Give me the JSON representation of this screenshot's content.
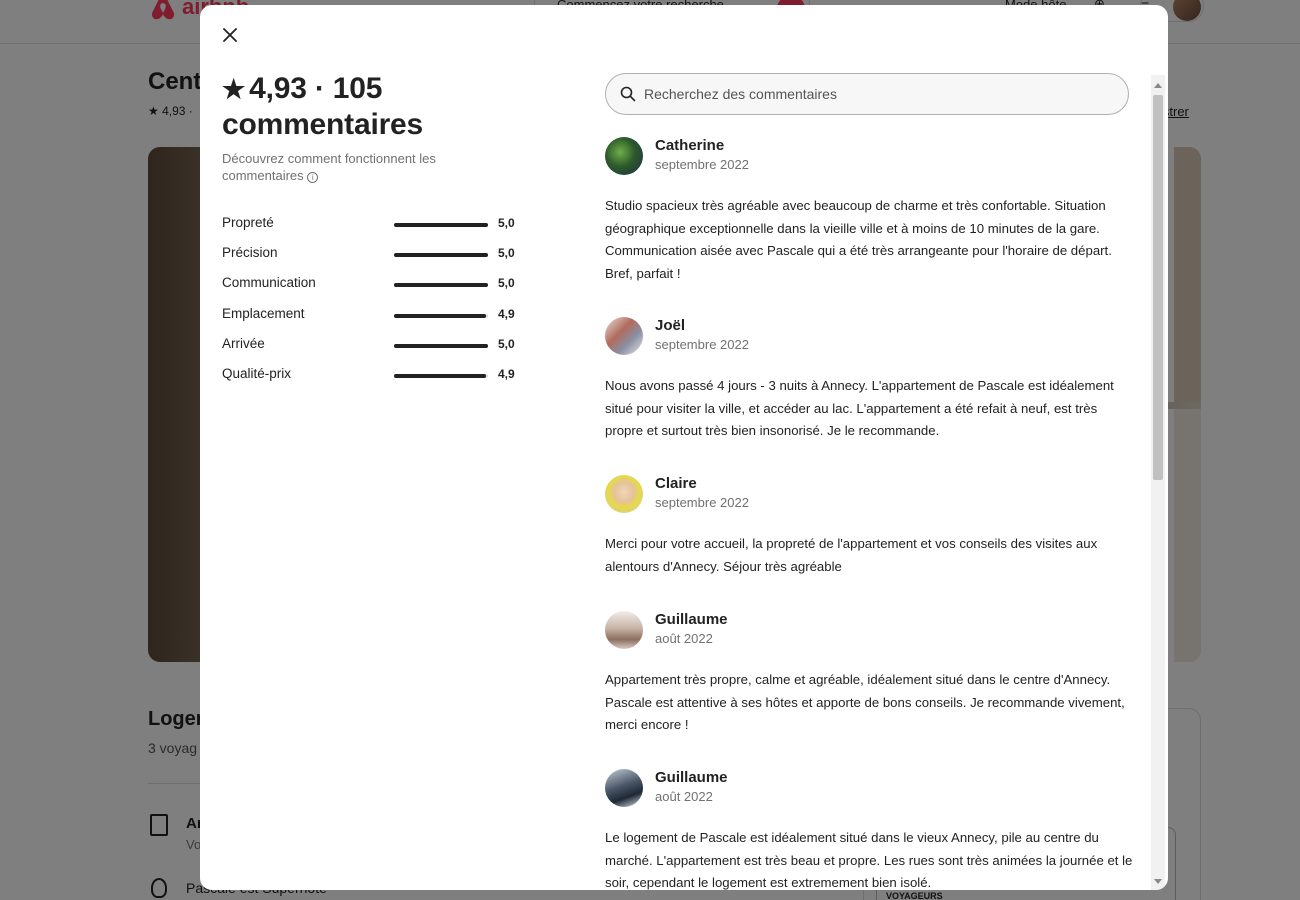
{
  "background": {
    "logo_text": "airbnb",
    "search_text": "Commencez votre recherche",
    "host_mode": "Mode hôte",
    "listing_title": "Cent",
    "listing_sub": "★ 4,93 ·",
    "save_link": "istrer",
    "lodging_heading": "Logem",
    "guests_text": "3 voyag",
    "amenity_1": "Ar",
    "amenity_1_sub": "Vo",
    "amenity_2": "Pascale est Superhôte",
    "card_label": "VOYAGEURS"
  },
  "modal": {
    "close_label": "×",
    "rating": "4,93",
    "review_count_label": "105 commentaires",
    "separator": "·",
    "how_reviews_work": "Découvrez comment fonctionnent les commentaires",
    "info_icon": "i",
    "categories": [
      {
        "name": "Propreté",
        "score": "5,0",
        "value": 5.0
      },
      {
        "name": "Précision",
        "score": "5,0",
        "value": 5.0
      },
      {
        "name": "Communication",
        "score": "5,0",
        "value": 5.0
      },
      {
        "name": "Emplacement",
        "score": "4,9",
        "value": 4.9
      },
      {
        "name": "Arrivée",
        "score": "5,0",
        "value": 5.0
      },
      {
        "name": "Qualité-prix",
        "score": "4,9",
        "value": 4.9
      }
    ],
    "search": {
      "placeholder": "Recherchez des commentaires",
      "value": ""
    },
    "reviews": [
      {
        "name": "Catherine",
        "date": "septembre 2022",
        "text": "Studio spacieux très agréable avec beaucoup de charme et très confortable. Situation géographique exceptionnelle dans la vieille ville et à moins de 10 minutes de la gare. Communication aisée avec Pascale qui a été très arrangeante pour l'horaire de départ. Bref, parfait !"
      },
      {
        "name": "Joël",
        "date": "septembre 2022",
        "text": "Nous avons passé 4 jours - 3 nuits à Annecy. L'appartement de Pascale est idéalement situé pour visiter la ville, et accéder au lac. L'appartement a été refait à neuf, est très propre et surtout très bien insonorisé. Je le recommande."
      },
      {
        "name": "Claire",
        "date": "septembre 2022",
        "text": "Merci pour votre accueil, la propreté de l'appartement et vos conseils des visites aux alentours d'Annecy. Séjour très agréable"
      },
      {
        "name": "Guillaume",
        "date": "août 2022",
        "text": "Appartement très propre, calme et agréable, idéalement situé dans le centre d'Annecy. Pascale est attentive à ses hôtes et apporte de bons conseils. Je recommande vivement, merci encore !"
      },
      {
        "name": "Guillaume",
        "date": "août 2022",
        "text": "Le logement de Pascale est idéalement situé dans le vieux Annecy, pile au centre du marché. L'appartement est très beau et propre. Les rues sont très animées la journée et le soir, cependant le logement est extremement bien isolé."
      }
    ]
  }
}
